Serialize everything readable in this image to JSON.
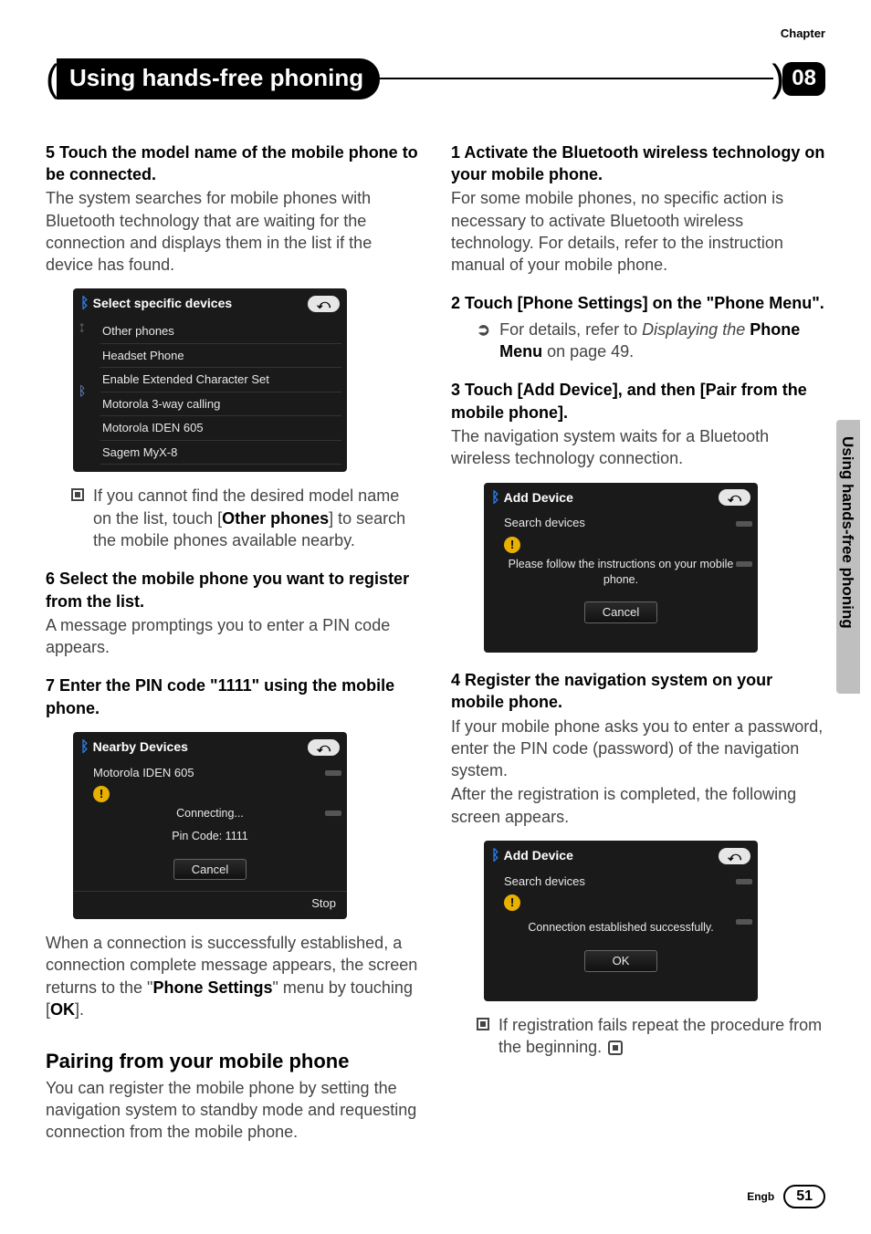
{
  "chapter_label": "Chapter",
  "chapter_number": "08",
  "page_title": "Using hands-free phoning",
  "side_tab_text": "Using hands-free phoning",
  "footer_lang": "Engb",
  "footer_page": "51",
  "left": {
    "step5_head": "5    Touch the model name of the mobile phone to be connected.",
    "step5_body": "The system searches for mobile phones with Bluetooth technology that are waiting for the connection and displays them in the list if the device has found.",
    "ss1": {
      "title": "Select specific devices",
      "back": "⤺",
      "items": [
        "Other phones",
        "Headset Phone",
        "Enable Extended Character Set",
        "Motorola 3-way calling",
        "Motorola IDEN 605",
        "Sagem MyX-8"
      ]
    },
    "note1_a": "If you cannot find the desired model name on the list, touch [",
    "note1_b": "Other phones",
    "note1_c": "] to search the mobile phones available nearby.",
    "step6_head": "6    Select the mobile phone you want to register from the list.",
    "step6_body": "A message promptings you to enter a PIN code appears.",
    "step7_head": "7    Enter the PIN code \"1111\" using the mobile phone.",
    "ss2": {
      "title": "Nearby Devices",
      "back": "⤺",
      "sub": "Motorola IDEN 605",
      "line1": "Connecting...",
      "line2": "Pin Code: 1111",
      "cancel": "Cancel",
      "stop": "Stop"
    },
    "after_ss2_a": "When a connection is successfully established, a connection complete message appears, the screen returns to the \"",
    "after_ss2_b": "Phone Settings",
    "after_ss2_c": "\" menu by touching [",
    "after_ss2_d": "OK",
    "after_ss2_e": "].",
    "pairing_h2": "Pairing from your mobile phone",
    "pairing_body": "You can register the mobile phone by setting the navigation system to standby mode and requesting connection from the mobile phone."
  },
  "right": {
    "step1_head": "1    Activate the Bluetooth wireless technology on your mobile phone.",
    "step1_body": "For some mobile phones, no specific action is necessary to activate Bluetooth wireless technology. For details, refer to the instruction manual of your mobile phone.",
    "step2_head": "2    Touch [Phone Settings] on the \"Phone Menu\".",
    "step2_sub_a": "For details, refer to ",
    "step2_sub_b": "Displaying the",
    "step2_sub_c": " Phone Menu",
    "step2_sub_d": " on page 49.",
    "step3_head": "3    Touch [Add Device], and then [Pair from the mobile phone].",
    "step3_body": "The navigation system waits for a Bluetooth wireless technology connection.",
    "ss3": {
      "title": "Add Device",
      "back": "⤺",
      "sub": "Search devices",
      "msg": "Please follow the instructions on your mobile phone.",
      "cancel": "Cancel"
    },
    "step4_head": "4    Register the navigation system on your mobile phone.",
    "step4_body1": "If your mobile phone asks you to enter a password, enter the PIN code (password) of the navigation system.",
    "step4_body2": "After the registration is completed, the following screen appears.",
    "ss4": {
      "title": "Add Device",
      "back": "⤺",
      "sub": "Search devices",
      "msg": "Connection established successfully.",
      "ok": "OK"
    },
    "note2": "If registration fails repeat the procedure from the beginning."
  }
}
